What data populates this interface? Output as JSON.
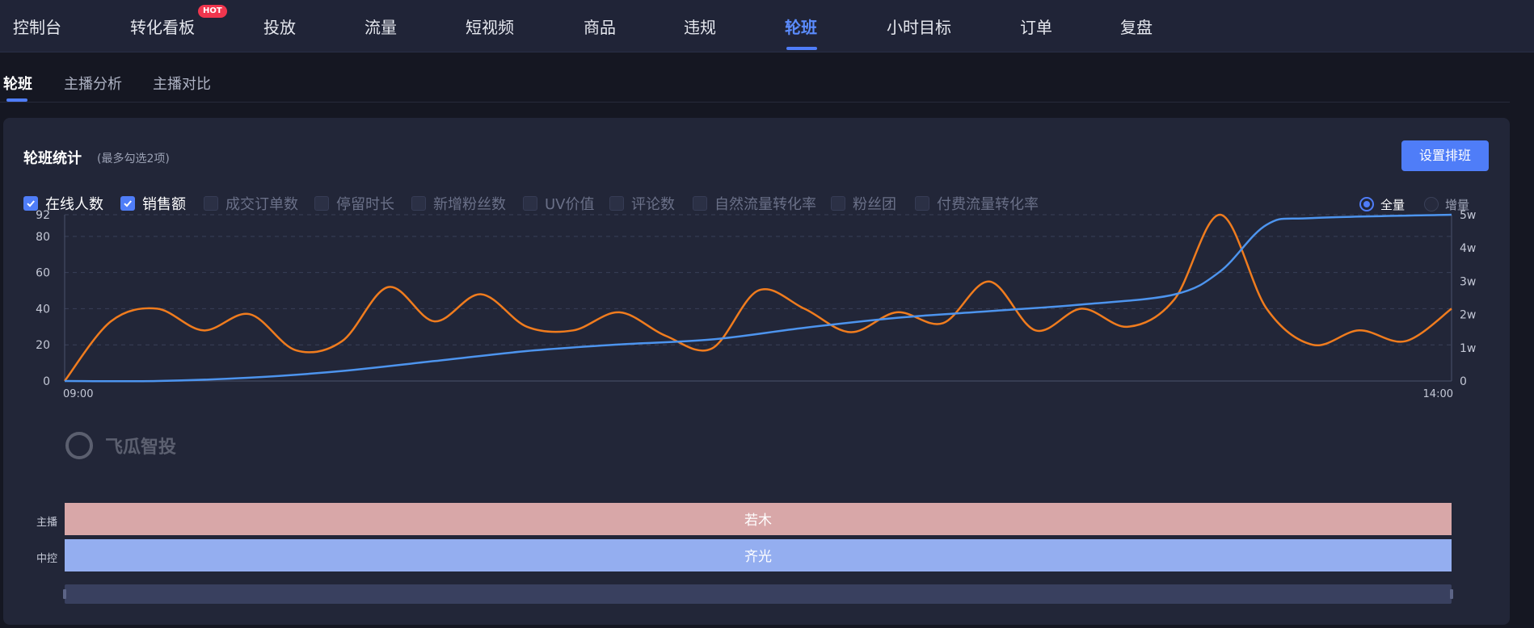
{
  "nav": {
    "items": [
      "控制台",
      "转化看板",
      "投放",
      "流量",
      "短视频",
      "商品",
      "违规",
      "轮班",
      "小时目标",
      "订单",
      "复盘"
    ],
    "active_index": 7,
    "hot_badge": "HOT"
  },
  "subnav": {
    "items": [
      "轮班",
      "主播分析",
      "主播对比"
    ],
    "active_index": 0
  },
  "panel": {
    "title": "轮班统计",
    "hint": "(最多勾选2项)",
    "button": "设置排班",
    "metrics": [
      {
        "label": "在线人数",
        "checked": true
      },
      {
        "label": "销售额",
        "checked": true
      },
      {
        "label": "成交订单数",
        "checked": false
      },
      {
        "label": "停留时长",
        "checked": false
      },
      {
        "label": "新增粉丝数",
        "checked": false
      },
      {
        "label": "UV价值",
        "checked": false
      },
      {
        "label": "评论数",
        "checked": false
      },
      {
        "label": "自然流量转化率",
        "checked": false
      },
      {
        "label": "粉丝团",
        "checked": false
      },
      {
        "label": "付费流量转化率",
        "checked": false
      }
    ],
    "modes": [
      {
        "label": "全量",
        "selected": true
      },
      {
        "label": "增量",
        "selected": false
      }
    ],
    "watermark": "飞瓜智投"
  },
  "chart_data": {
    "type": "line",
    "x_labels": [
      "09:00",
      "14:00"
    ],
    "x_range": [
      "09:00",
      "14:00"
    ],
    "y_left": {
      "ticks": [
        0,
        20,
        40,
        60,
        80,
        92
      ],
      "range": [
        0,
        92
      ]
    },
    "y_right": {
      "ticks": [
        "0",
        "1w",
        "2w",
        "3w",
        "4w",
        "5w"
      ],
      "range": [
        0,
        50000
      ]
    },
    "grid": true,
    "series": [
      {
        "name": "在线人数",
        "axis": "left",
        "color": "#f07c1e",
        "x": [
          "09:00",
          "09:10",
          "09:20",
          "09:30",
          "09:40",
          "09:50",
          "10:00",
          "10:10",
          "10:20",
          "10:30",
          "10:40",
          "10:50",
          "11:00",
          "11:10",
          "11:20",
          "11:30",
          "11:40",
          "11:50",
          "12:00",
          "12:10",
          "12:20",
          "12:30",
          "12:40",
          "12:50",
          "13:00",
          "13:10",
          "13:20",
          "13:30",
          "13:40",
          "13:50",
          "14:00"
        ],
        "values": [
          0,
          33,
          40,
          28,
          37,
          17,
          22,
          52,
          33,
          48,
          30,
          28,
          38,
          25,
          18,
          50,
          40,
          27,
          38,
          32,
          55,
          28,
          40,
          30,
          45,
          92,
          40,
          20,
          28,
          22,
          40
        ]
      },
      {
        "name": "销售额",
        "axis": "right",
        "color": "#4d94ee",
        "x": [
          "09:00",
          "09:20",
          "09:40",
          "10:00",
          "10:20",
          "10:40",
          "11:00",
          "11:20",
          "11:40",
          "12:00",
          "12:20",
          "12:40",
          "13:00",
          "13:10",
          "13:20",
          "13:30",
          "14:00"
        ],
        "values": [
          0,
          0,
          1000,
          3000,
          6000,
          9000,
          11000,
          12500,
          16000,
          19000,
          21000,
          23000,
          26000,
          33000,
          47000,
          49000,
          50000
        ]
      }
    ]
  },
  "schedule": {
    "rows": [
      {
        "label": "主播",
        "name": "若木",
        "color": "#d8a7a8"
      },
      {
        "label": "中控",
        "name": "齐光",
        "color": "#94aef0"
      }
    ]
  }
}
